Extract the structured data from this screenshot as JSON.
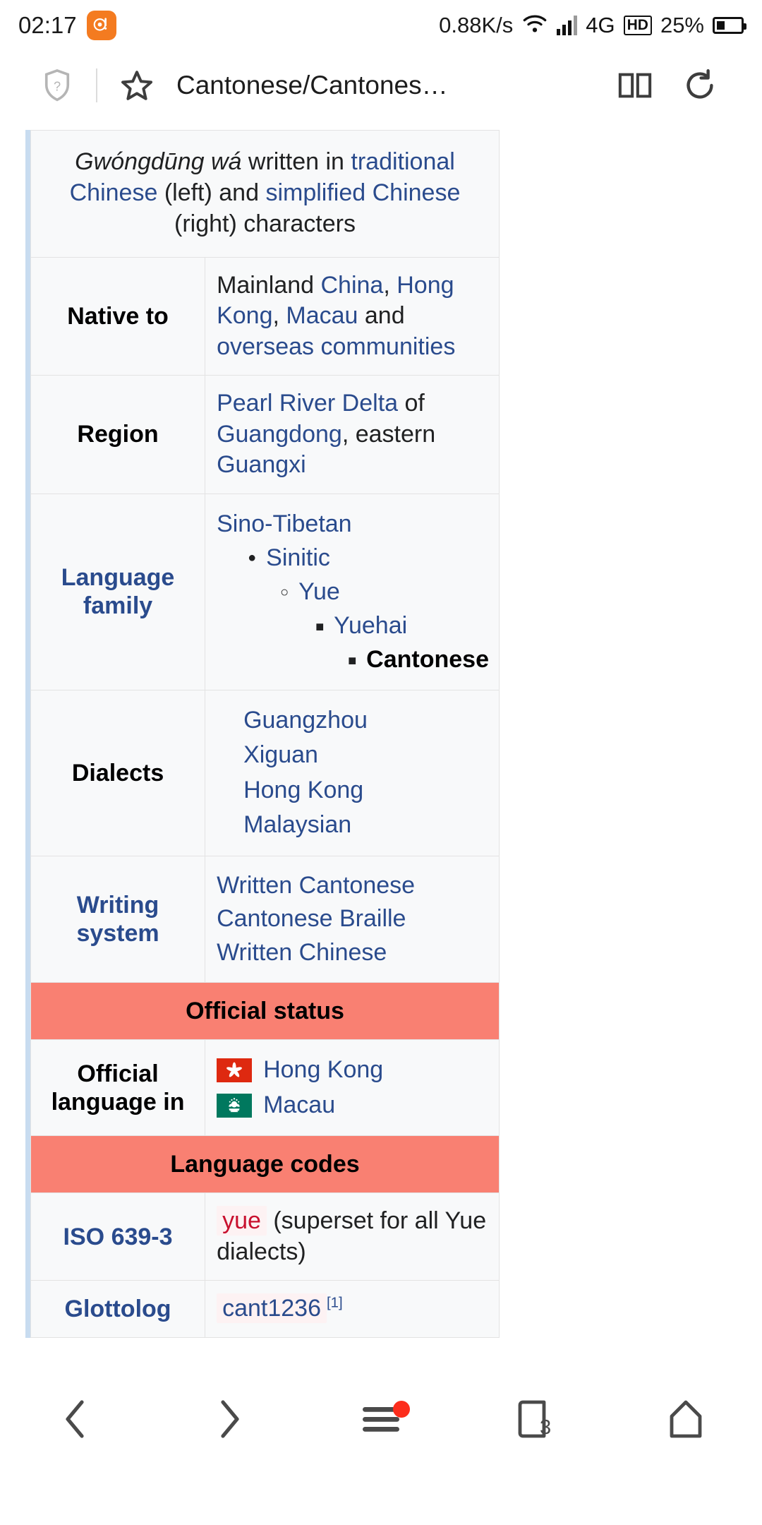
{
  "status_bar": {
    "time": "02:17",
    "app_icon": "qq-notification-icon",
    "network_speed": "0.88K/s",
    "wifi_icon": "wifi-icon",
    "signal_icon": "signal-bars-icon",
    "network_type": "4G",
    "hd_badge": "HD",
    "battery_percent": "25%",
    "battery_icon": "battery-icon"
  },
  "toolbar": {
    "shield_icon": "shield-question-icon",
    "star_icon": "star-icon",
    "title": "Cantonese/Cantones…",
    "book_icon": "reader-mode-icon",
    "reload_icon": "reload-icon"
  },
  "infobox": {
    "caption": {
      "romanization": "Gwóngdūng wá",
      "text_1": " written in ",
      "link_traditional": "traditional Chinese",
      "text_2": " (left) and ",
      "link_simplified": "simplified Chinese",
      "text_3": " (right) characters"
    },
    "native_to": {
      "label": "Native to",
      "t1": "Mainland ",
      "l1": "China",
      "t2": ", ",
      "l2": "Hong Kong",
      "t3": ", ",
      "l3": "Macau",
      "t4": " and ",
      "l4": "overseas communities"
    },
    "region": {
      "label": "Region",
      "l1": "Pearl River Delta",
      "t1": " of ",
      "l2": "Guangdong",
      "t2": ", eastern ",
      "l3": "Guangxi"
    },
    "language_family": {
      "label": "Language family",
      "root": "Sino-Tibetan",
      "level1": "Sinitic",
      "level2": "Yue",
      "level3": "Yuehai",
      "level4": "Cantonese"
    },
    "dialects": {
      "label": "Dialects",
      "items": [
        "Guangzhou",
        "Xiguan",
        "Hong Kong",
        "Malaysian"
      ]
    },
    "writing_system": {
      "label": "Writing system",
      "items": [
        "Written Cantonese",
        "Cantonese Braille",
        "Written Chinese"
      ]
    },
    "official_status_header": "Official status",
    "official_language_in": {
      "label": "Official language in",
      "items": [
        {
          "flag": "hong-kong-flag",
          "name": "Hong Kong"
        },
        {
          "flag": "macau-flag",
          "name": "Macau"
        }
      ]
    },
    "language_codes_header": "Language codes",
    "iso": {
      "label": "ISO 639-3",
      "code": "yue",
      "note": "(superset for all Yue dialects)"
    },
    "glottolog": {
      "label": "Glottolog",
      "code": "cant1236",
      "ref": "[1]"
    }
  },
  "bottom_nav": {
    "back_icon": "chevron-left-icon",
    "forward_icon": "chevron-right-icon",
    "menu_icon": "hamburger-menu-icon",
    "menu_badge": "notification-dot",
    "tabs_icon": "tabs-icon",
    "tabs_count": "3",
    "home_icon": "home-icon"
  },
  "colors": {
    "link_blue": "#2a4b8d",
    "section_salmon": "#f98072",
    "accent_border": "#c8dcf0",
    "badge_red": "#fc2d1c",
    "app_orange": "#f47b20"
  }
}
